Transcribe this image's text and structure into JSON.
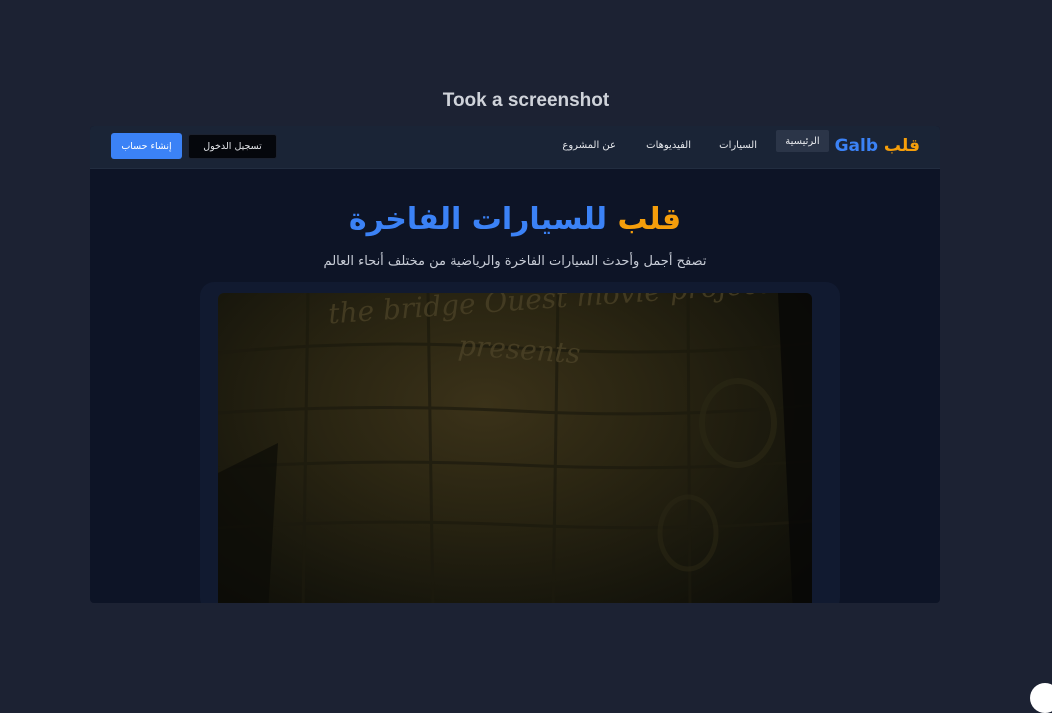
{
  "caption": "Took a screenshot",
  "navbar": {
    "brand_en": "Galb",
    "brand_ar": "قلب",
    "links": {
      "home": "الرئيسية",
      "cars": "السيارات",
      "videos": "الفيديوهات",
      "about": "عن المشروع"
    },
    "login_label": "تسجيل الدخول",
    "signup_label": "إنشاء حساب"
  },
  "hero": {
    "title_part1": "قلب",
    "title_part2": "للسيارات الفاخرة",
    "subtitle": "تصفح أجمل وأحدث السيارات الفاخرة والرياضية من مختلف أنحاء العالم"
  },
  "video": {
    "overlay_line1": "the bridge Ouest movie project",
    "overlay_line2": "presents"
  },
  "colors": {
    "accent_blue": "#3b82f6",
    "accent_orange": "#f59e0b",
    "page_bg": "#1c2233",
    "frame_bg": "#0d1426"
  }
}
